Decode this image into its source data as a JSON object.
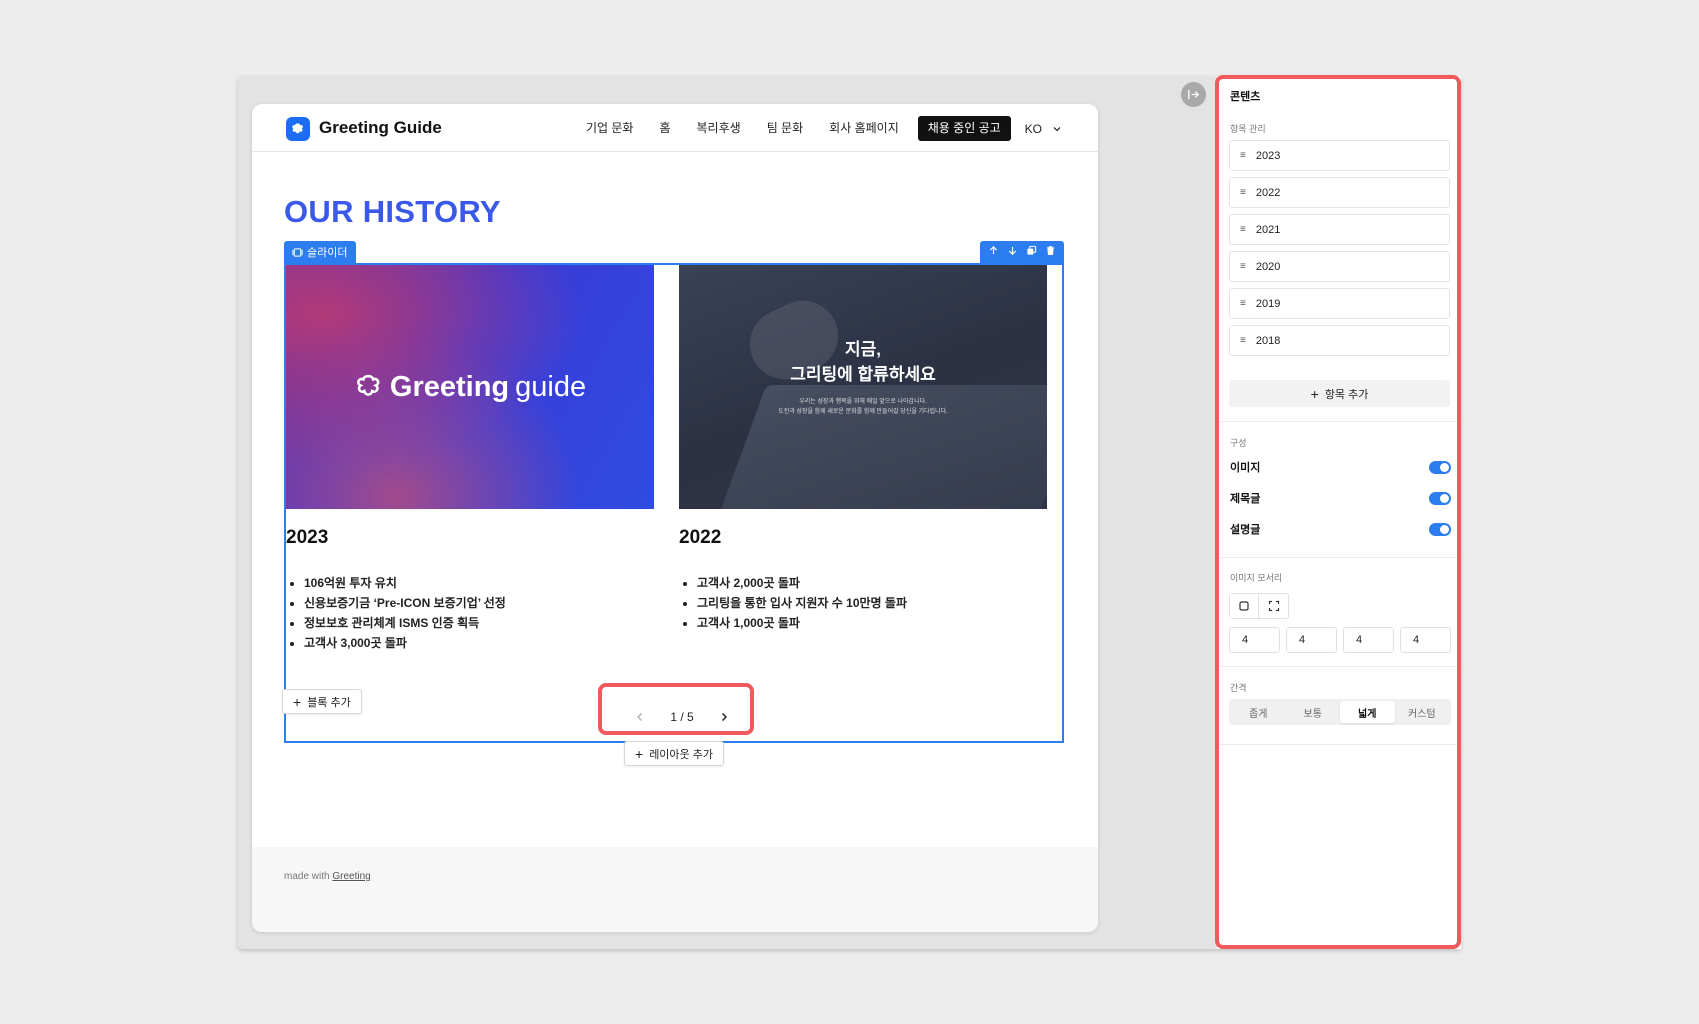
{
  "nav": {
    "logo_text": "Greeting Guide",
    "items": [
      "기업 문화",
      "홈",
      "복리후생",
      "팀 문화",
      "회사 홈페이지"
    ],
    "cta": "채용 중인 공고",
    "lang": "KO"
  },
  "history_title": "OUR HISTORY",
  "slider": {
    "tag": "슬라이더",
    "slides": [
      {
        "brand_word1": "Greeting",
        "brand_word2": "guide",
        "year": "2023",
        "items": [
          "106억원 투자 유치",
          "신용보증기금 ‘Pre-ICON 보증기업’ 선정",
          "정보보호 관리체계 ISMS 인증 획득",
          "고객사 3,000곳 돌파"
        ]
      },
      {
        "image_heading_line1": "지금,",
        "image_heading_line2": "그리팅에 합류하세요",
        "image_sub_line1": "우리는 성장과 행복을 위해 매일 앞으로 나아갑니다.",
        "image_sub_line2": "도전과 성장을 함께 새로운 문화를 함께 만들어갈 당신을 기다립니다.",
        "year": "2022",
        "items": [
          "고객사 2,000곳 돌파",
          "그리팅을 통한 입사 지원자 수 10만명 돌파",
          "고객사 1,000곳 돌파"
        ]
      }
    ],
    "pager": "1 / 5"
  },
  "add_block": "블록 추가",
  "add_layout": "레이아웃 추가",
  "footer": {
    "prefix": "made with",
    "link": "Greeting"
  },
  "panel": {
    "title": "콘텐츠",
    "items_label": "항목 관리",
    "items": [
      "2023",
      "2022",
      "2021",
      "2020",
      "2019",
      "2018"
    ],
    "add_item": "항목 추가",
    "config_label": "구성",
    "toggles": [
      {
        "label": "이미지",
        "on": true
      },
      {
        "label": "제목글",
        "on": true
      },
      {
        "label": "설명글",
        "on": true
      }
    ],
    "corner_label": "이미지 모서리",
    "corner_values": [
      "4",
      "4",
      "4",
      "4"
    ],
    "spacing_label": "간격",
    "spacing_options": [
      "좁게",
      "보통",
      "넓게",
      "커스텀"
    ],
    "spacing_selected": "넓게"
  },
  "colors": {
    "accent": "#2c7df0",
    "title": "#3a58ea",
    "highlight": "#f05a5c"
  }
}
